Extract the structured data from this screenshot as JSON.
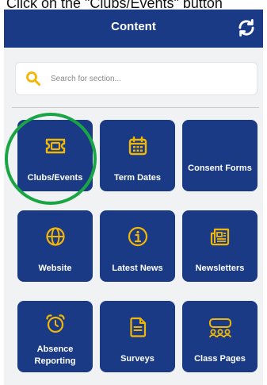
{
  "instruction": "Click on the \"Clubs/Events\" button",
  "header": {
    "title": "Content",
    "refresh_icon": "refresh-icon"
  },
  "search": {
    "placeholder": "Search for section..."
  },
  "tiles": [
    {
      "label": "Clubs/Events",
      "icon": "ticket-icon"
    },
    {
      "label": "Term Dates",
      "icon": "calendar-icon"
    },
    {
      "label": "Consent Forms",
      "icon": "none"
    },
    {
      "label": "Website",
      "icon": "globe-icon"
    },
    {
      "label": "Latest News",
      "icon": "info-icon"
    },
    {
      "label": "Newsletters",
      "icon": "newspaper-icon"
    },
    {
      "label": "Absence Reporting",
      "icon": "alarm-clock-icon"
    },
    {
      "label": "Surveys",
      "icon": "document-icon"
    },
    {
      "label": "Class Pages",
      "icon": "group-icon"
    }
  ],
  "colors": {
    "header": "#1a3a86",
    "tile": "#1a3a86",
    "icon_accent": "#f2b705",
    "highlight": "#1aa545",
    "background": "#f1f2f4"
  }
}
